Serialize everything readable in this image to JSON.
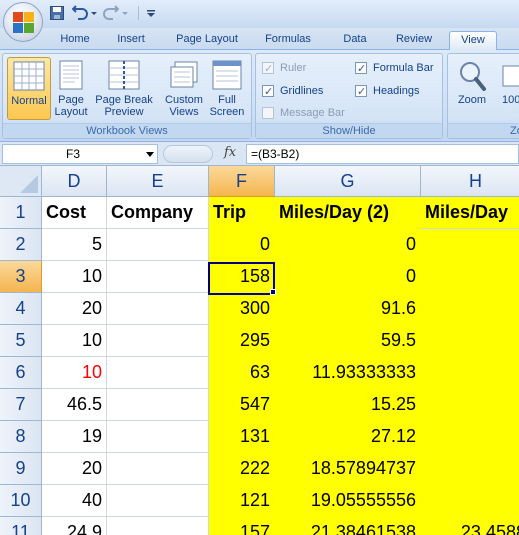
{
  "titlebar": {
    "qat": [
      "save-icon",
      "undo-icon",
      "redo-icon",
      "customize-qat-icon"
    ]
  },
  "tabs": [
    "Home",
    "Insert",
    "Page Layout",
    "Formulas",
    "Data",
    "Review",
    "View"
  ],
  "active_tab": "View",
  "ribbon": {
    "workbook_views": {
      "label": "Workbook Views",
      "buttons": [
        {
          "line1": "Normal",
          "line2": ""
        },
        {
          "line1": "Page",
          "line2": "Layout"
        },
        {
          "line1": "Page Break",
          "line2": "Preview"
        },
        {
          "line1": "Custom",
          "line2": "Views"
        },
        {
          "line1": "Full",
          "line2": "Screen"
        }
      ]
    },
    "show_hide": {
      "label": "Show/Hide",
      "ruler": "Ruler",
      "gridlines": "Gridlines",
      "message_bar": "Message Bar",
      "formula_bar": "Formula Bar",
      "headings": "Headings"
    },
    "zoom": {
      "label": "Zo",
      "zoom_button": "Zoom",
      "hundred": "100"
    }
  },
  "formula_bar": {
    "name_box": "F3",
    "fx": "fx",
    "formula": "=(B3-B2)"
  },
  "grid": {
    "columns": [
      "D",
      "E",
      "F",
      "G",
      "H"
    ],
    "selected_column": "F",
    "rows": [
      "1",
      "2",
      "3",
      "4",
      "5",
      "6",
      "7",
      "8",
      "9",
      "10",
      "11"
    ],
    "selected_row": "3",
    "header_row": [
      "Cost",
      "Company",
      "Trip",
      "Miles/Day (2)",
      "Miles/Day"
    ],
    "data": [
      [
        "5",
        "",
        "0",
        "0",
        ""
      ],
      [
        "10",
        "",
        "158",
        "0",
        ""
      ],
      [
        "20",
        "",
        "300",
        "91.6",
        ""
      ],
      [
        "10",
        "",
        "295",
        "59.5",
        ""
      ],
      [
        "10",
        "",
        "63",
        "11.93333333",
        ""
      ],
      [
        "46.5",
        "",
        "547",
        "15.25",
        ""
      ],
      [
        "19",
        "",
        "131",
        "27.12",
        ""
      ],
      [
        "20",
        "",
        "222",
        "18.57894737",
        ""
      ],
      [
        "40",
        "",
        "121",
        "19.05555556",
        ""
      ],
      [
        "24.9",
        "",
        "157",
        "21.38461538",
        "23.4588"
      ]
    ],
    "red_text_color": "#ff0000",
    "highlight_color": "#ffff00",
    "active_cell": "F3"
  }
}
